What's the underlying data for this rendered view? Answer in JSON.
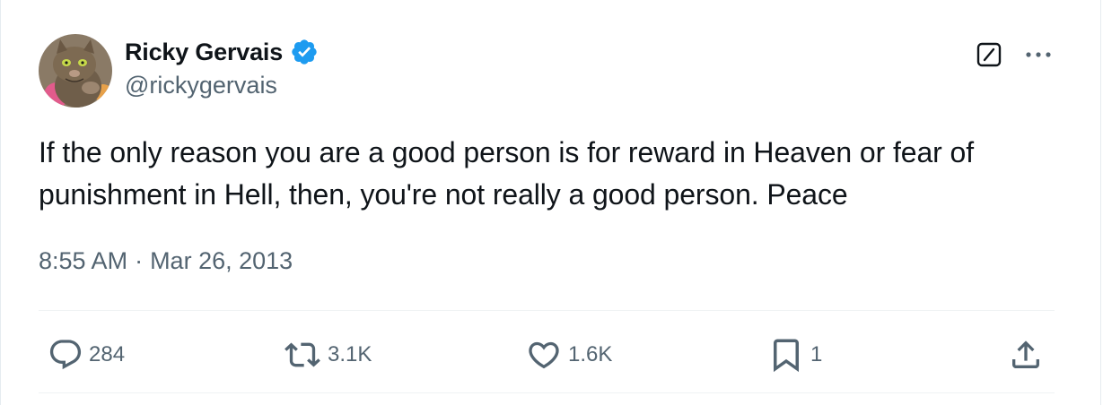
{
  "tweet": {
    "author": {
      "display_name": "Ricky Gervais",
      "handle": "@rickygervais",
      "verified": true,
      "avatar_icon": "cat-avatar"
    },
    "text": "If the only reason you are a good person is for reward in Heaven or fear of punishment in Hell, then, you're not really a good person. Peace",
    "time": "8:55 AM",
    "separator": "·",
    "date": "Mar 26, 2013",
    "stats": {
      "replies": "284",
      "retweets": "3.1K",
      "likes": "1.6K",
      "bookmarks": "1"
    }
  },
  "icons": {
    "verified": "verified-badge-icon",
    "grok": "grok-icon",
    "more": "more-icon",
    "reply": "reply-icon",
    "retweet": "retweet-icon",
    "like": "heart-icon",
    "bookmark": "bookmark-icon",
    "share": "share-icon"
  },
  "colors": {
    "text_primary": "#0f1419",
    "text_secondary": "#536471",
    "verified_blue": "#1d9bf0",
    "divider": "#eff3f4"
  }
}
